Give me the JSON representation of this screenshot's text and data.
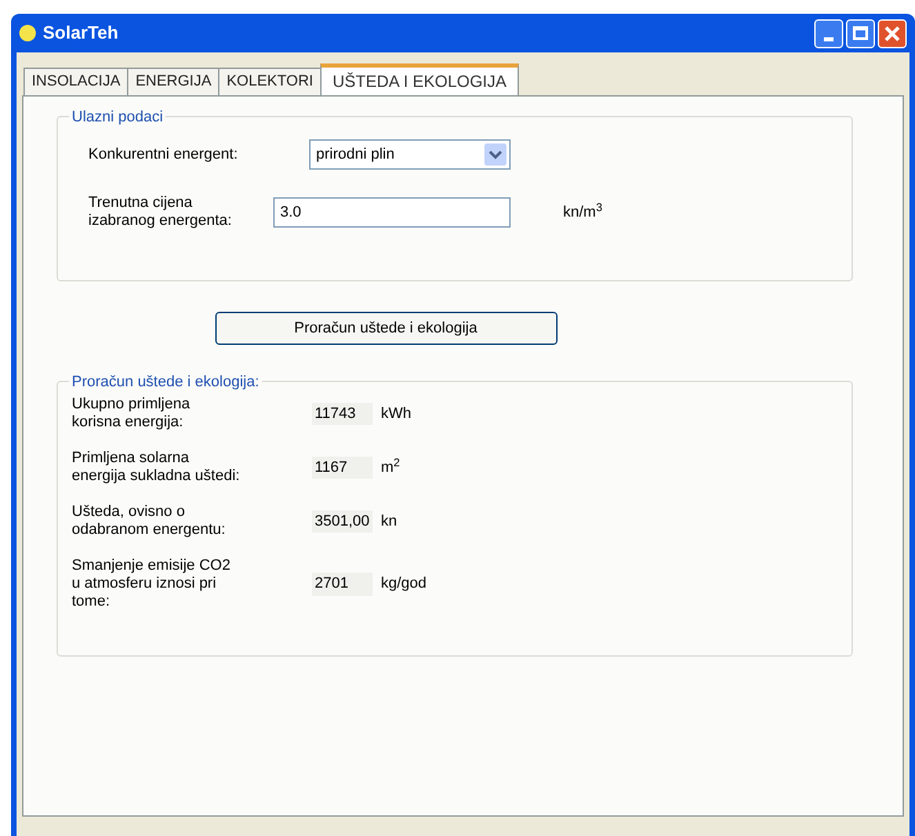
{
  "window": {
    "title": "SolarTeh"
  },
  "tabs": [
    {
      "label": "INSOLACIJA",
      "selected": false
    },
    {
      "label": "ENERGIJA",
      "selected": false
    },
    {
      "label": "KOLEKTORI",
      "selected": false
    },
    {
      "label": "UŠTEDA I EKOLOGIJA",
      "selected": true
    }
  ],
  "input_group": {
    "title": "Ulazni podaci",
    "energent_label": "Konkurentni energent:",
    "energent_value": "prirodni plin",
    "price_label": "Trenutna cijena izabranog energenta:",
    "price_value": "3.0",
    "price_unit": "kn/m$^{3}$"
  },
  "calculate_button": "Proračun uštede i ekologija",
  "results_group": {
    "title": "Proračun uštede i ekologija:",
    "rows": [
      {
        "label": "Ukupno primljena korisna energija:",
        "value": "11743",
        "unit": "kWh"
      },
      {
        "label": "Primljena solarna energija sukladna uštedi:",
        "value": "1167",
        "unit": "m$^{2}$"
      },
      {
        "label": "Ušteda, ovisno o odabranom energentu:",
        "value": "3501,00",
        "unit": "kn"
      },
      {
        "label": "Smanjenje emisije CO2 u atmosferu iznosi pri tome:",
        "value": "2701",
        "unit": "kg/god"
      }
    ]
  }
}
